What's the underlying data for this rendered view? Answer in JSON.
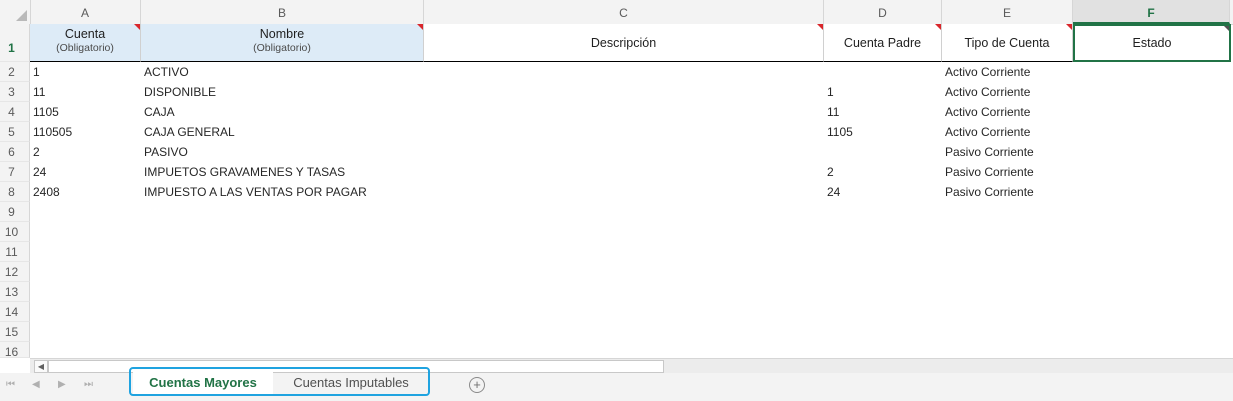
{
  "column_letters": [
    "A",
    "B",
    "C",
    "D",
    "E",
    "F"
  ],
  "row_numbers": [
    "1",
    "2",
    "3",
    "4",
    "5",
    "6",
    "7",
    "8",
    "9",
    "10",
    "11",
    "12",
    "13",
    "14",
    "15",
    "16"
  ],
  "headers": {
    "cuenta": {
      "main": "Cuenta",
      "sub": "(Obligatorio)"
    },
    "nombre": {
      "main": "Nombre",
      "sub": "(Obligatorio)"
    },
    "descripcion": "Descripción",
    "cuenta_padre": "Cuenta Padre",
    "tipo_cuenta": "Tipo de Cuenta",
    "estado": "Estado"
  },
  "rows": [
    {
      "cuenta": "1",
      "nombre": "ACTIVO",
      "descripcion": "",
      "padre": "",
      "tipo": "Activo Corriente",
      "estado": ""
    },
    {
      "cuenta": "11",
      "nombre": "DISPONIBLE",
      "descripcion": "",
      "padre": "1",
      "tipo": "Activo Corriente",
      "estado": ""
    },
    {
      "cuenta": "1105",
      "nombre": "CAJA",
      "descripcion": "",
      "padre": "11",
      "tipo": "Activo Corriente",
      "estado": ""
    },
    {
      "cuenta": "110505",
      "nombre": "CAJA GENERAL",
      "descripcion": "",
      "padre": "1105",
      "tipo": "Activo Corriente",
      "estado": ""
    },
    {
      "cuenta": "2",
      "nombre": "PASIVO",
      "descripcion": "",
      "padre": "",
      "tipo": "Pasivo Corriente",
      "estado": ""
    },
    {
      "cuenta": "24",
      "nombre": "IMPUETOS GRAVAMENES Y TASAS",
      "descripcion": "",
      "padre": "2",
      "tipo": "Pasivo Corriente",
      "estado": ""
    },
    {
      "cuenta": "2408",
      "nombre": "IMPUESTO A LAS VENTAS POR PAGAR",
      "descripcion": "",
      "padre": "24",
      "tipo": "Pasivo Corriente",
      "estado": ""
    }
  ],
  "sheet_tabs": [
    {
      "label": "Cuentas Mayores",
      "active": true
    },
    {
      "label": "Cuentas Imputables",
      "active": false
    }
  ],
  "add_sheet_label": "+",
  "nav_glyphs": [
    "⏮",
    "◀",
    "▶",
    "⏭"
  ],
  "colors": {
    "accent": "#217346",
    "header_fill": "#ddebf7",
    "comment_marker": "#d9262b",
    "tab_highlight": "#1fa3e0"
  }
}
